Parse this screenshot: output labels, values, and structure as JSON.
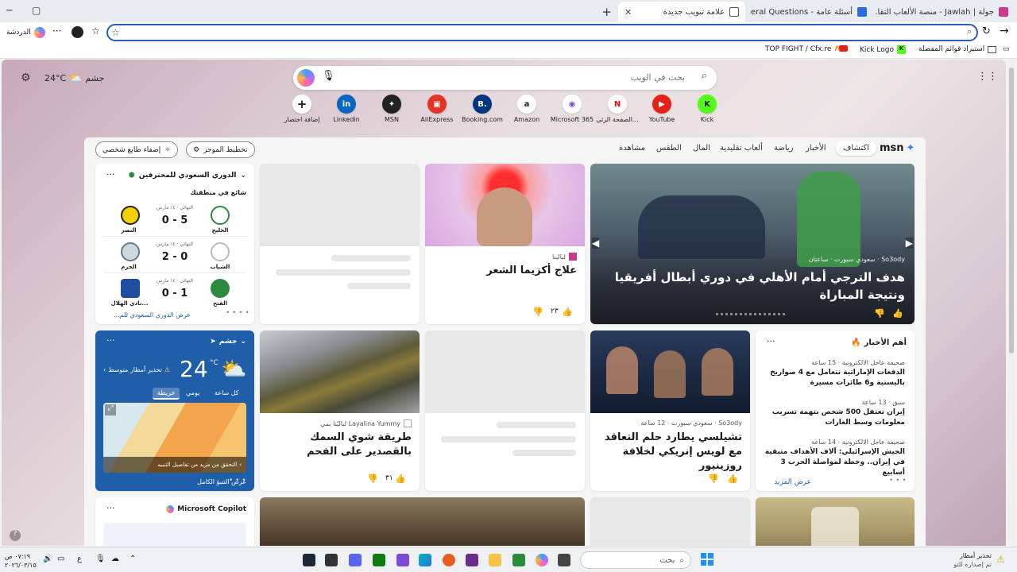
{
  "tabs": [
    {
      "title": "جولة | Jawlah - منصة الألعاب التقا...",
      "active": false
    },
    {
      "title": "أسئلة عامة - General Questions",
      "active": false
    },
    {
      "title": "علامة تبويب جديدة",
      "active": true
    }
  ],
  "toolbar": {
    "profile_label": "الدردشة",
    "address_value": ""
  },
  "bookmarks": [
    "استيراد قوائم المفضلة",
    "Kick Logo",
    "TOP FIGHT / Cfx.re"
  ],
  "header": {
    "weather_city": "جشم",
    "weather_temp": "24",
    "weather_unit": "°C",
    "search_placeholder": "بحث في الويب"
  },
  "quick_links": [
    "Kick",
    "YouTube",
    "الصفحة الرئي...",
    "Microsoft 365",
    "Amazon",
    "Booking.com",
    "AliExpress",
    "MSN",
    "Linkedin",
    "إضافة اختصار"
  ],
  "feed_nav": {
    "brand": "msn",
    "items": [
      "اكتشاف",
      "الأخبار",
      "رياضة",
      "ألعاب تقليدية",
      "المال",
      "الطقس",
      "مشاهدة"
    ],
    "personalize": "إضفاء طابع شخصي",
    "layout": "تخطيط الموجز"
  },
  "hero": {
    "source": "So3ody · سعودي سبورت · ساعتان",
    "title": "هدف الترجي أمام الأهلي في دوري أبطال أفريقيا ونتيجة المباراة"
  },
  "eczema": {
    "source": "ليالينا",
    "title": "علاج أكزيما الشعر",
    "likes": "٢٣"
  },
  "league": {
    "name": "الدوري السعودي للمحترفين",
    "trending": "شائع في منطقتك",
    "see_all": "عرض الدوري السعودي للم...",
    "matches": [
      {
        "status": "النهائي · ١٤ مارس",
        "home": "الخليج",
        "away": "النصر",
        "score": "0 - 5"
      },
      {
        "status": "النهائي · ١٤ مارس",
        "home": "الشباب",
        "away": "الحزم",
        "score": "2 - 0"
      },
      {
        "status": "النهائي · ١٤ مارس",
        "home": "الفتح",
        "away": "نادي الهلال...",
        "score": "0 - 1"
      }
    ]
  },
  "weather": {
    "city": "جشم",
    "temp": "24",
    "unit": "°C",
    "alert": "تحذير أمطار متوسط",
    "tabs": [
      "كل ساعة",
      "يومي",
      "خريطة"
    ],
    "map_link": "التحقق من مزيد من تفاصيل التنبيه",
    "full": "عرض التنبؤ الكامل"
  },
  "fish": {
    "source": "Layalina Yummy لياليّنا يمي",
    "title": "طريقة شوي السمك بالقصدير على الفحم",
    "likes": "٣١"
  },
  "chelsea": {
    "source": "So3ody · سعودي سبورت · 12 ساعة",
    "title": "تشيلسي يطارد حلم التعاقد مع لويس إنريكي لخلافة روزينيور"
  },
  "top_news": {
    "title": "أهم الأخبار",
    "see_more": "عرض المزيد",
    "items": [
      {
        "source": "صحيفة عاجل الالكترونية · 15 ساعة",
        "text": "الدفعات الإماراتية تتعامل مع 4 صواريخ باليستية و6 طائرات مسيرة"
      },
      {
        "source": "سبق · 13 ساعة",
        "text": "إيران تعتقل 500 شخص بتهمة تسريب معلومات وسط الغارات"
      },
      {
        "source": "صحيفة عاجل الالكترونية · 14 ساعة",
        "text": "الجيش الإسرائيلي: آلاف الأهداف متبقية في إيران.. وخطة لمواصلة الحرب 3 أسابيع"
      }
    ]
  },
  "copilot": {
    "title": "Microsoft Copilot"
  },
  "taskbar": {
    "search": "بحث",
    "weather_title": "تحذير أمطار",
    "weather_sub": "تم إصداره للتو",
    "time": "٠٧:١٩ ص",
    "date": "٢٠٢٦/٠٣/١٥",
    "lang": "ع"
  }
}
